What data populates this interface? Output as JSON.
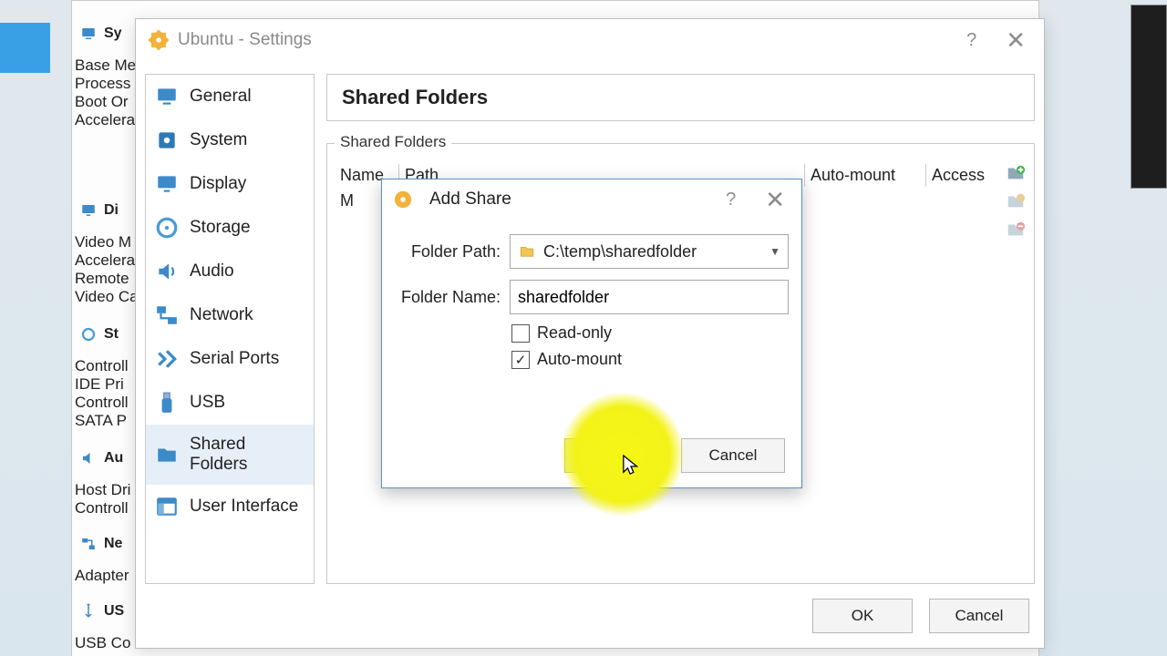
{
  "bg": {
    "system_title": "Sy",
    "system_lines": [
      "Base Me",
      "Process",
      "Boot Or",
      "Accelera"
    ],
    "display_title": "Di",
    "display_lines": [
      "Video M",
      "Accelera",
      "Remote",
      "Video Ca"
    ],
    "storage_title": "St",
    "storage_lines": [
      "Controll",
      "IDE Pri",
      "Controll",
      "SATA P"
    ],
    "audio_title": "Au",
    "audio_lines": [
      "Host Dri",
      "Controll"
    ],
    "network_title": "Ne",
    "network_lines": [
      "Adapter"
    ],
    "usb_title": "US",
    "usb_lines": [
      "USB Co"
    ]
  },
  "settings": {
    "window_title": "Ubuntu - Settings",
    "nav": [
      "General",
      "System",
      "Display",
      "Storage",
      "Audio",
      "Network",
      "Serial Ports",
      "USB",
      "Shared Folders",
      "User Interface"
    ],
    "content_title": "Shared Folders",
    "group_label": "Shared Folders",
    "cols": {
      "name": "Name",
      "path": "Path",
      "automount": "Auto-mount",
      "access": "Access"
    },
    "row_prefix": "M",
    "footer_ok": "OK",
    "footer_cancel": "Cancel"
  },
  "dialog": {
    "title": "Add Share",
    "folder_path_label": "Folder Path:",
    "folder_path_value": "C:\\temp\\sharedfolder",
    "folder_name_label": "Folder Name:",
    "folder_name_value": "sharedfolder",
    "readonly_label": "Read-only",
    "automount_label": "Auto-mount",
    "ok": "OK",
    "cancel": "Cancel"
  }
}
